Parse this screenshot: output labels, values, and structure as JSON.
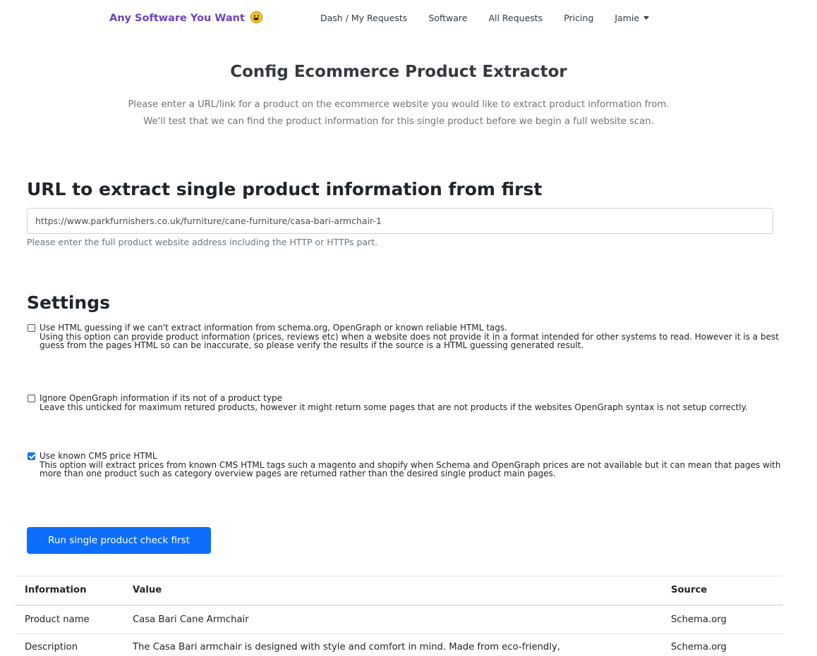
{
  "nav": {
    "brand": "Any Software You Want",
    "brand_icon": "grinning-face-icon",
    "links": [
      "Dash / My Requests",
      "Software",
      "All Requests",
      "Pricing"
    ],
    "user": "Jamie"
  },
  "header": {
    "title": "Config Ecommerce Product Extractor",
    "subtitle_line1": "Please enter a URL/link for a product on the ecommerce website you would like to extract product information from.",
    "subtitle_line2": "We'll test that we can find the product information for this single product before we begin a full website scan."
  },
  "url_section": {
    "title": "URL to extract single product information from first",
    "input_value": "https://www.parkfurnishers.co.uk/furniture/cane-furniture/casa-bari-armchair-1",
    "help": "Please enter the full product website address including the HTTP or HTTPs part."
  },
  "settings": {
    "title": "Settings",
    "items": [
      {
        "checked": false,
        "label": "Use HTML guessing if we can't extract information from schema.org, OpenGraph or known reliable HTML tags.",
        "description": "Using this option can provide product information (prices, reviews etc) when a website does not provide it in a format intended for other systems to read. However it is a best guess from the pages HTML so can be inaccurate, so please verify the results if the source is a HTML guessing generated result."
      },
      {
        "checked": false,
        "label": "Ignore OpenGraph information if its not of a product type",
        "description": "Leave this unticked for maximum retured products, however it might return some pages that are not products if the websites OpenGraph syntax is not setup correctly."
      },
      {
        "checked": true,
        "label": "Use known CMS price HTML",
        "description": "This option will extract prices from known CMS HTML tags such a magento and shopify when Schema and OpenGraph prices are not available but it can mean that pages with more than one product such as category overview pages are returned rather than the desired single product main pages."
      }
    ]
  },
  "run_button": "Run single product check first",
  "table": {
    "headers": [
      "Information",
      "Value",
      "Source"
    ],
    "rows": [
      [
        "Product name",
        "Casa Bari Cane Armchair",
        "Schema.org"
      ],
      [
        "Description",
        "The Casa Bari armchair is designed with style and comfort in mind. Made from eco-friendly,",
        "Schema.org"
      ]
    ]
  },
  "colors": {
    "brand": "#6f42c1",
    "primary": "#0d6efd",
    "checkbox": "#1a73e8"
  }
}
